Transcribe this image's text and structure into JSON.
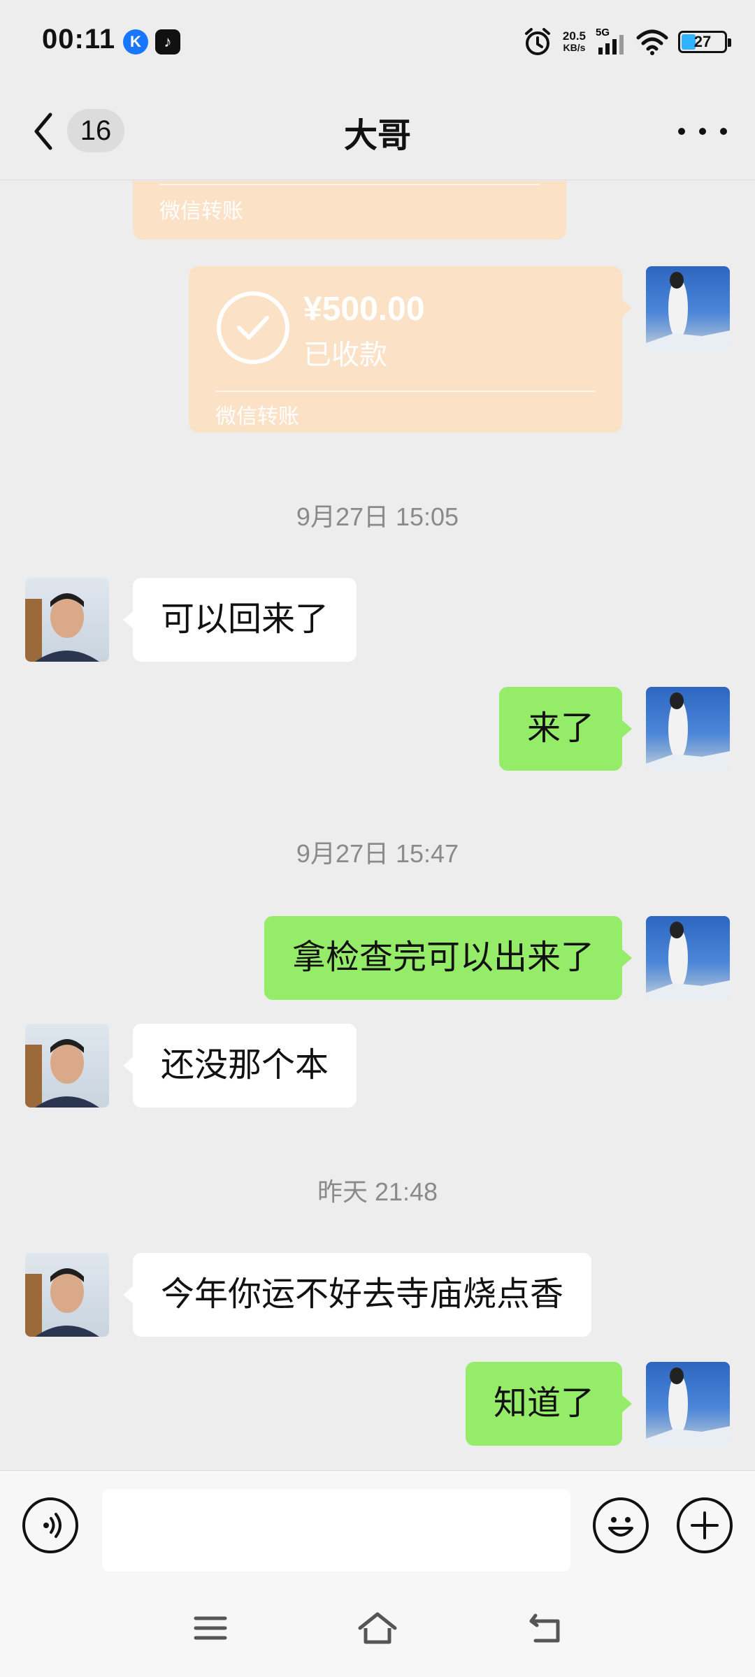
{
  "status_bar": {
    "time": "00:11",
    "app_icons": [
      "kuaishou-k-icon",
      "tiktok-icon"
    ],
    "network_speed": "20.5",
    "network_unit": "KB/s",
    "network_type": "5G",
    "battery": "27",
    "icons": [
      "alarm-icon",
      "signal-icon",
      "wifi-icon",
      "battery-icon"
    ]
  },
  "nav": {
    "unread_count": "16",
    "title": "大哥"
  },
  "chat": {
    "transfer_partial": {
      "label": "微信转账"
    },
    "transfer": {
      "amount": "¥500.00",
      "status": "已收款",
      "label": "微信转账"
    },
    "timestamps": [
      "9月27日 15:05",
      "9月27日 15:47",
      "昨天 21:48"
    ],
    "messages": [
      {
        "side": "friend",
        "text": "可以回来了"
      },
      {
        "side": "me",
        "text": "来了"
      },
      {
        "side": "me",
        "text": "拿检查完可以出来了"
      },
      {
        "side": "friend",
        "text": "还没那个本"
      },
      {
        "side": "friend",
        "text": "今年你运不好去寺庙烧点香"
      },
      {
        "side": "me",
        "text": "知道了"
      }
    ]
  },
  "input_bar": {
    "icons": [
      "voice-icon",
      "emoji-icon",
      "plus-icon"
    ],
    "value": ""
  },
  "system_nav": {
    "icons": [
      "menu-icon",
      "home-icon",
      "back-icon"
    ]
  },
  "colors": {
    "bg": "#ededed",
    "me_bubble": "#95ec69",
    "friend_bubble": "#ffffff",
    "transfer": "#fbe1c5"
  }
}
